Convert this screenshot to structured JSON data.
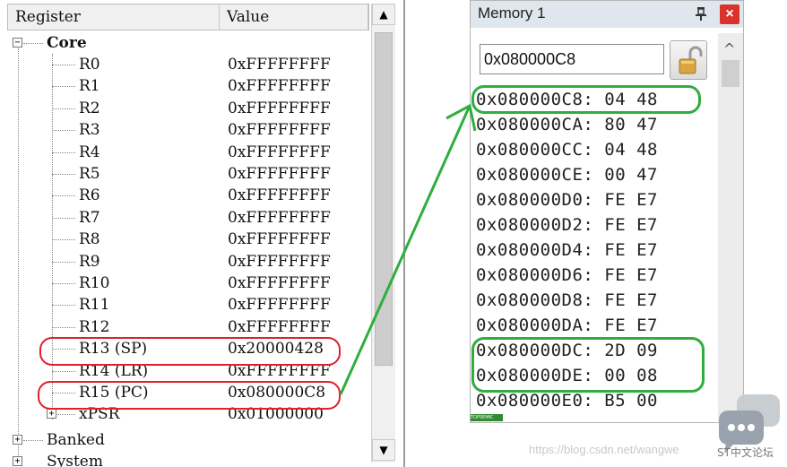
{
  "register_window": {
    "columns": {
      "register": "Register",
      "value": "Value"
    },
    "core_label": "Core",
    "registers": [
      {
        "name": "R0",
        "value": "0xFFFFFFFF"
      },
      {
        "name": "R1",
        "value": "0xFFFFFFFF"
      },
      {
        "name": "R2",
        "value": "0xFFFFFFFF"
      },
      {
        "name": "R3",
        "value": "0xFFFFFFFF"
      },
      {
        "name": "R4",
        "value": "0xFFFFFFFF"
      },
      {
        "name": "R5",
        "value": "0xFFFFFFFF"
      },
      {
        "name": "R6",
        "value": "0xFFFFFFFF"
      },
      {
        "name": "R7",
        "value": "0xFFFFFFFF"
      },
      {
        "name": "R8",
        "value": "0xFFFFFFFF"
      },
      {
        "name": "R9",
        "value": "0xFFFFFFFF"
      },
      {
        "name": "R10",
        "value": "0xFFFFFFFF"
      },
      {
        "name": "R11",
        "value": "0xFFFFFFFF"
      },
      {
        "name": "R12",
        "value": "0xFFFFFFFF"
      },
      {
        "name": "R13 (SP)",
        "value": "0x20000428"
      },
      {
        "name": "R14 (LR)",
        "value": "0xFFFFFFFF"
      },
      {
        "name": "R15 (PC)",
        "value": "0x080000C8"
      },
      {
        "name": "xPSR",
        "value": "0x01000000"
      }
    ],
    "banked_label": "Banked",
    "system_label": "System"
  },
  "memory_window": {
    "title": "Memory 1",
    "address_input": "0x080000C8",
    "rows": [
      "0x080000C8: 04 48",
      "0x080000CA: 80 47",
      "0x080000CC: 04 48",
      "0x080000CE: 00 47",
      "0x080000D0: FE E7",
      "0x080000D2: FE E7",
      "0x080000D4: FE E7",
      "0x080000D6: FE E7",
      "0x080000D8: FE E7",
      "0x080000DA: FE E7",
      "0x080000DC: 2D 09",
      "0x080000DE: 00 08",
      "0x080000E0: B5 00"
    ],
    "footer_tag": "TOPSEMIC"
  },
  "watermark": "https://blog.csdn.net/wangwe",
  "forum_label": "ST中文论坛",
  "colors": {
    "highlight_red": "#e0202a",
    "highlight_green": "#2fae3f",
    "close_red": "#d9342b"
  }
}
